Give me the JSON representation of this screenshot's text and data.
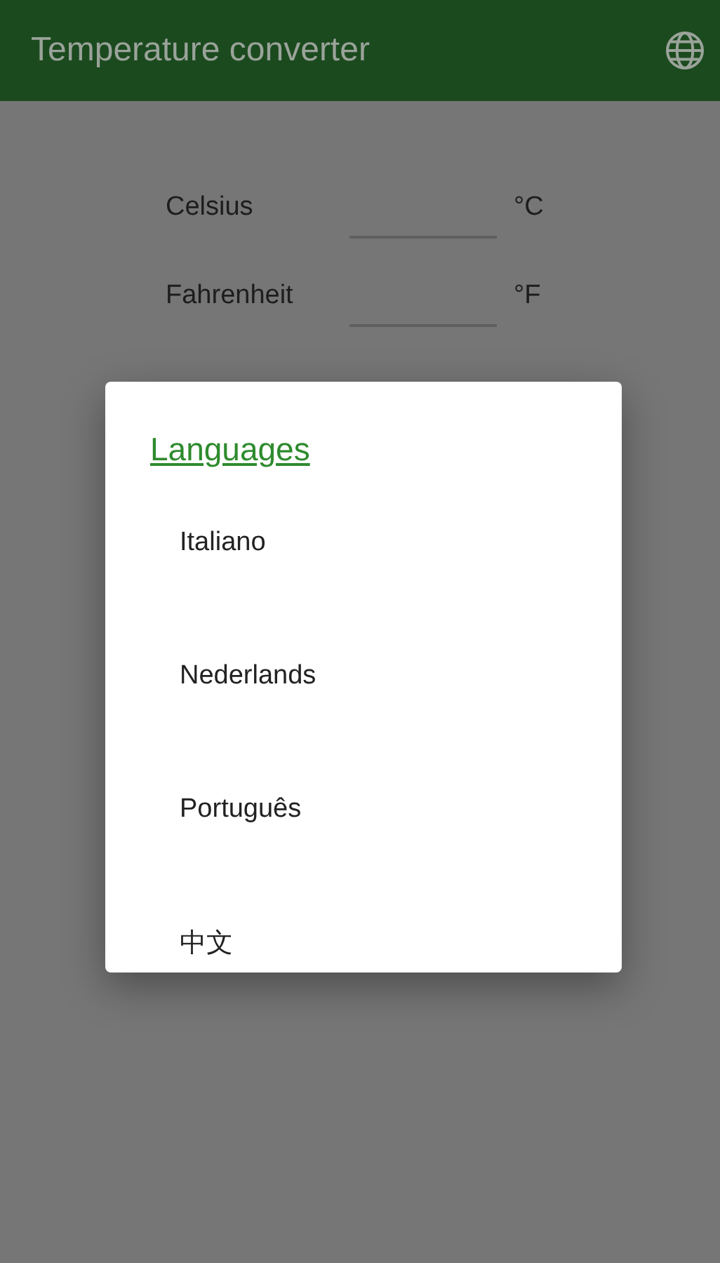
{
  "app_bar": {
    "title": "Temperature converter"
  },
  "rows": [
    {
      "label": "Celsius",
      "unit": "°C"
    },
    {
      "label": "Fahrenheit",
      "unit": "°F"
    }
  ],
  "dialog": {
    "title": "Languages",
    "items": [
      "Italiano",
      "Nederlands",
      "Português",
      "中文"
    ]
  }
}
